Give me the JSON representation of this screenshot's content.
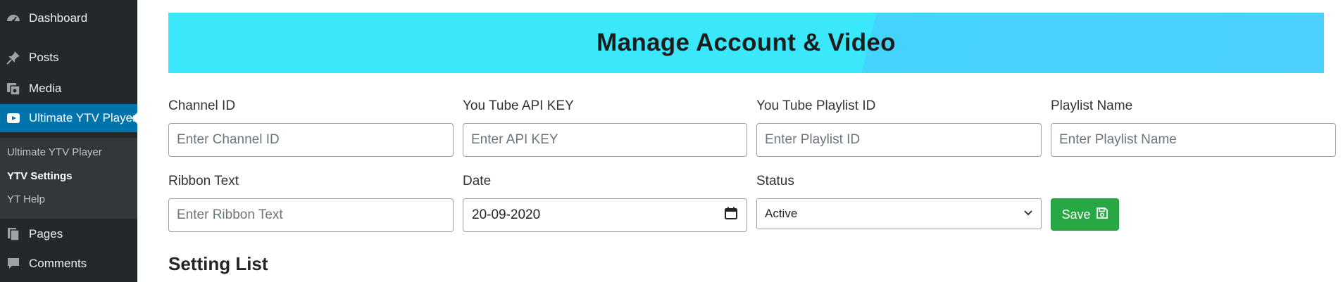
{
  "sidebar": {
    "items": [
      {
        "label": "Dashboard",
        "icon": "dashboard-icon"
      },
      {
        "label": "Posts",
        "icon": "pin-icon"
      },
      {
        "label": "Media",
        "icon": "media-icon"
      },
      {
        "label": "Ultimate YTV Player",
        "icon": "youtube-icon",
        "active": true
      },
      {
        "label": "Pages",
        "icon": "pages-icon"
      },
      {
        "label": "Comments",
        "icon": "comment-icon"
      }
    ],
    "submenu": [
      {
        "label": "Ultimate YTV Player"
      },
      {
        "label": "YTV Settings",
        "current": true
      },
      {
        "label": "YT Help"
      }
    ]
  },
  "banner": {
    "title": "Manage Account & Video"
  },
  "form": {
    "channel_id": {
      "label": "Channel ID",
      "placeholder": "Enter Channel ID",
      "value": ""
    },
    "api_key": {
      "label": "You Tube API KEY",
      "placeholder": "Enter API KEY",
      "value": ""
    },
    "playlist_id": {
      "label": "You Tube Playlist ID",
      "placeholder": "Enter Playlist ID",
      "value": ""
    },
    "playlist_name": {
      "label": "Playlist Name",
      "placeholder": "Enter Playlist Name",
      "value": ""
    },
    "ribbon_text": {
      "label": "Ribbon Text",
      "placeholder": "Enter Ribbon Text",
      "value": ""
    },
    "date": {
      "label": "Date",
      "value": "20-09-2020"
    },
    "status": {
      "label": "Status",
      "value": "Active"
    },
    "save_label": "Save"
  },
  "section": {
    "title": "Setting List"
  },
  "colors": {
    "sidebar_bg": "#23282d",
    "submenu_bg": "#32373c",
    "active_menu": "#0073aa",
    "banner_cyan": "#3be8fb",
    "banner_blue": "#4ad0fb",
    "save_green": "#28a745"
  }
}
